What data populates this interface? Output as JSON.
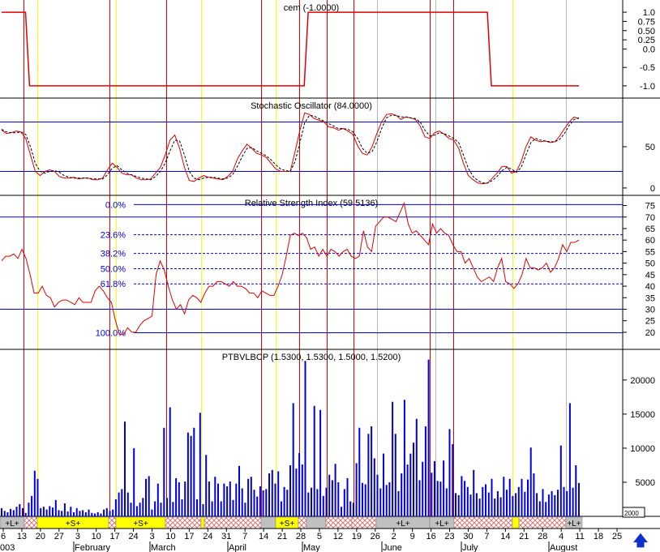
{
  "colors": {
    "red": "#e00000",
    "yellow": "#ffff00",
    "gray": "#b8b8b8",
    "blue": "#0000dd",
    "black": "#000000",
    "band_yellow": "#ffff00",
    "band_gray": "#c0c0c0",
    "band_hatch": "#e06060"
  },
  "chart_data": [
    {
      "type": "line",
      "title": "cem (-1.0000)",
      "ylim": [
        -1.2,
        1.2
      ],
      "y_ticks": [
        "1.0",
        "0.75",
        "0.50",
        "0.25",
        "0.0",
        "-0.5",
        "-1.0"
      ],
      "series": [
        {
          "x": [
            0,
            6,
            7,
            76,
            77,
            122,
            123,
            145
          ],
          "values": [
            1.0,
            1.0,
            -1.0,
            -1.0,
            1.0,
            1.0,
            -1.0,
            -1.0
          ]
        }
      ]
    },
    {
      "type": "line",
      "title": "Stochastic Oscillator (84.0000)",
      "ylim": [
        -5,
        105
      ],
      "y_ticks": [
        "50",
        "0"
      ],
      "reference_lines": [
        20,
        80
      ],
      "series": [
        {
          "style": "solid",
          "values": [
            70,
            66,
            67,
            69,
            68,
            60,
            40,
            20,
            15,
            20,
            22,
            20,
            14,
            12,
            12,
            13,
            11,
            12,
            12,
            10,
            10,
            12,
            22,
            30,
            25,
            18,
            16,
            16,
            12,
            10,
            10,
            11,
            18,
            25,
            40,
            58,
            64,
            48,
            25,
            9,
            8,
            12,
            15,
            13,
            12,
            11,
            10,
            14,
            20,
            35,
            45,
            53,
            48,
            42,
            40,
            37,
            30,
            23,
            20,
            20,
            20,
            44,
            70,
            91,
            89,
            84,
            82,
            80,
            74,
            73,
            70,
            72,
            69,
            65,
            51,
            42,
            40,
            50,
            66,
            80,
            89,
            90,
            88,
            83,
            86,
            85,
            83,
            75,
            62,
            60,
            67,
            69,
            65,
            60,
            58,
            48,
            30,
            15,
            10,
            6,
            5,
            6,
            12,
            18,
            26,
            26,
            18,
            20,
            32,
            50,
            62,
            58,
            56,
            57,
            55,
            56,
            63,
            72,
            80,
            86,
            84
          ]
        },
        {
          "style": "dash",
          "values": [
            71,
            68,
            67,
            67,
            68,
            65,
            50,
            30,
            20,
            18,
            20,
            21,
            19,
            15,
            13,
            12,
            12,
            12,
            12,
            11,
            11,
            11,
            16,
            24,
            27,
            22,
            18,
            16,
            14,
            12,
            11,
            10,
            14,
            20,
            30,
            45,
            58,
            57,
            40,
            20,
            12,
            10,
            12,
            13,
            13,
            12,
            11,
            12,
            16,
            26,
            38,
            48,
            49,
            45,
            42,
            39,
            34,
            28,
            23,
            21,
            20,
            32,
            55,
            79,
            88,
            87,
            84,
            81,
            78,
            75,
            72,
            72,
            71,
            68,
            60,
            48,
            42,
            44,
            56,
            72,
            85,
            88,
            88,
            86,
            86,
            85,
            84,
            80,
            70,
            63,
            64,
            67,
            66,
            63,
            60,
            55,
            40,
            24,
            14,
            9,
            6,
            6,
            9,
            14,
            21,
            25,
            23,
            19,
            25,
            40,
            55,
            60,
            58,
            57,
            56,
            56,
            59,
            66,
            76,
            83,
            85
          ]
        }
      ]
    },
    {
      "type": "line",
      "title": "Relative Strength Index (59.5136)",
      "ylim": [
        14,
        78
      ],
      "y_ticks": [
        "75",
        "70",
        "65",
        "60",
        "55",
        "50",
        "45",
        "40",
        "35",
        "30",
        "25",
        "20"
      ],
      "reference_lines": [
        30,
        70
      ],
      "fib_levels": [
        {
          "label": "0.0%",
          "value": 75.4
        },
        {
          "label": "23.6%",
          "value": 62.3
        },
        {
          "label": "38.2%",
          "value": 54.2
        },
        {
          "label": "50.0%",
          "value": 47.6
        },
        {
          "label": "61.8%",
          "value": 41.0
        },
        {
          "label": "100.0%",
          "value": 19.8
        }
      ],
      "series": [
        {
          "values": [
            51,
            53,
            53,
            54,
            52,
            56,
            52,
            45,
            37,
            37,
            40,
            36,
            35,
            31,
            33,
            34,
            34,
            33,
            32,
            35,
            33,
            33,
            33,
            38,
            40,
            38,
            35,
            33,
            25,
            19,
            19,
            22,
            20,
            20,
            23,
            25,
            26,
            27,
            45,
            51,
            47,
            40,
            34,
            30,
            32,
            28,
            34,
            36,
            35,
            33,
            37,
            40,
            40,
            42,
            42,
            41,
            40,
            42,
            40,
            40,
            39,
            37,
            37,
            35,
            38,
            37,
            36,
            36,
            40,
            45,
            53,
            62,
            63,
            62,
            63,
            61,
            56,
            57,
            53,
            56,
            53,
            56,
            55,
            53,
            55,
            56,
            53,
            52,
            53,
            64,
            57,
            55,
            66,
            68,
            70,
            70,
            69,
            68,
            72,
            76,
            67,
            63,
            64,
            62,
            60,
            58,
            67,
            63,
            65,
            63,
            62,
            58,
            55,
            55,
            50,
            52,
            48,
            44,
            42,
            43,
            44,
            42,
            48,
            52,
            42,
            41,
            39,
            41,
            45,
            52,
            48,
            48,
            47,
            48,
            50,
            46,
            48,
            52,
            58,
            55,
            59,
            59,
            60
          ]
        }
      ]
    },
    {
      "type": "bar",
      "title": "PTBVLBCP (1.5300, 1.5300, 1.5000, 1.5200)",
      "ylim": [
        0,
        24500
      ],
      "y_ticks": [
        "20000",
        "15000",
        "10000",
        "5000"
      ],
      "values": [
        1200,
        800,
        600,
        1100,
        900,
        1400,
        1800,
        1200,
        500,
        2000,
        3000,
        6700,
        5500,
        1200,
        1400,
        1000,
        1500,
        1300,
        2400,
        900,
        800,
        1900,
        700,
        1400,
        600,
        1200,
        800,
        900,
        600,
        1000,
        500,
        400,
        600,
        400,
        1000,
        1200,
        800,
        1000,
        2500,
        3500,
        4000,
        13900,
        3500,
        2000,
        10000,
        1500,
        2000,
        2700,
        5500,
        5900,
        1000,
        2200,
        4800,
        2000,
        13000,
        2700,
        16000,
        2100,
        5600,
        5000,
        2500,
        5100,
        12300,
        11800,
        13000,
        2500,
        15200,
        1800,
        9000,
        5100,
        2200,
        5800,
        4800,
        2200,
        4800,
        4400,
        5100,
        2400,
        4800,
        7400,
        4100,
        2000,
        5500,
        5800,
        3900,
        2900,
        4400,
        3800,
        4000,
        6300,
        6800,
        4800,
        6600,
        2200,
        4300,
        3900,
        7500,
        16600,
        7000,
        9300,
        7600,
        22800,
        3500,
        4200,
        16200,
        4000,
        15600,
        3000,
        4200,
        6100,
        5300,
        7700,
        5000,
        1400,
        4000,
        5600,
        2200,
        2000,
        7800,
        13000,
        4900,
        4700,
        12100,
        13200,
        8500,
        6100,
        4100,
        9200,
        4600,
        5000,
        16800,
        12100,
        3700,
        6300,
        17100,
        7600,
        9200,
        10800,
        14300,
        5300,
        8000,
        13200,
        23000,
        6400,
        8100,
        5200,
        5100,
        8200,
        4100,
        12800,
        10600,
        3400,
        3100,
        5900,
        5200,
        4300,
        3200,
        6800,
        3400,
        2600,
        4300,
        4700,
        3500,
        5500,
        2600,
        3700,
        2800,
        5800,
        3900,
        5500,
        3000,
        3400,
        4300,
        5500,
        3600,
        5400,
        10100,
        6300,
        3400,
        2200,
        4000,
        2100,
        3200,
        3700,
        3100,
        3900,
        10400,
        4300,
        3700,
        16600,
        4200,
        7500,
        4900
      ]
    }
  ],
  "x_axis": {
    "day_labels": [
      "6",
      "13",
      "20",
      "27",
      "3",
      "10",
      "17",
      "24",
      "3",
      "10",
      "17",
      "24",
      "31",
      "7",
      "14",
      "21",
      "28",
      "5",
      "12",
      "19",
      "26",
      "2",
      "9",
      "16",
      "23",
      "30",
      "7",
      "14",
      "21",
      "28",
      "4",
      "11",
      "18",
      "25"
    ],
    "month_labels": [
      "003",
      "February",
      "March",
      "April",
      "May",
      "June",
      "July",
      "August"
    ]
  },
  "signal_bands": [
    {
      "type": "L",
      "label": "+L+",
      "from": 0,
      "to": 30
    },
    {
      "type": "hatch",
      "label": "",
      "from": 30,
      "to": 46
    },
    {
      "type": "S",
      "label": "+S+",
      "from": 46,
      "to": 134
    },
    {
      "type": "hatch",
      "label": "",
      "from": 134,
      "to": 143
    },
    {
      "type": "S",
      "label": "+S+",
      "from": 143,
      "to": 204
    },
    {
      "type": "hatch",
      "label": "",
      "from": 204,
      "to": 248
    },
    {
      "type": "S",
      "label": "",
      "from": 248,
      "to": 252
    },
    {
      "type": "hatch",
      "label": "",
      "from": 252,
      "to": 322
    },
    {
      "type": "L",
      "label": "",
      "from": 322,
      "to": 340
    },
    {
      "type": "S",
      "label": "+S+",
      "from": 340,
      "to": 368
    },
    {
      "type": "hatch",
      "label": "",
      "from": 368,
      "to": 378
    },
    {
      "type": "L",
      "label": "",
      "from": 378,
      "to": 402
    },
    {
      "type": "hatch",
      "label": "",
      "from": 402,
      "to": 434
    },
    {
      "type": "hatch",
      "label": "",
      "from": 434,
      "to": 464
    },
    {
      "type": "L",
      "label": "+L+",
      "from": 464,
      "to": 530
    },
    {
      "type": "L",
      "label": "+L+",
      "from": 530,
      "to": 560
    },
    {
      "type": "hatch",
      "label": "",
      "from": 560,
      "to": 632
    },
    {
      "type": "S",
      "label": "",
      "from": 632,
      "to": 640
    },
    {
      "type": "hatch",
      "label": "",
      "from": 640,
      "to": 698
    },
    {
      "type": "L",
      "label": "+L+",
      "from": 698,
      "to": 718
    }
  ],
  "signal_lines": [
    {
      "x": 29,
      "color": "red"
    },
    {
      "x": 46,
      "color": "yellow"
    },
    {
      "x": 135,
      "color": "red"
    },
    {
      "x": 143,
      "color": "yellow"
    },
    {
      "x": 205,
      "color": "red"
    },
    {
      "x": 248,
      "color": "yellow"
    },
    {
      "x": 322,
      "color": "red"
    },
    {
      "x": 340,
      "color": "yellow"
    },
    {
      "x": 369,
      "color": "red"
    },
    {
      "x": 403,
      "color": "red"
    },
    {
      "x": 436,
      "color": "red"
    },
    {
      "x": 465,
      "color": "gray"
    },
    {
      "x": 530,
      "color": "red"
    },
    {
      "x": 537,
      "color": "gray"
    },
    {
      "x": 559,
      "color": "red"
    },
    {
      "x": 632,
      "color": "yellow"
    },
    {
      "x": 698,
      "color": "gray"
    }
  ],
  "nav": {
    "scroll_arrow": "up-arrow-icon",
    "arrow_glyph": "🡅"
  },
  "volume_box_label": "2000"
}
